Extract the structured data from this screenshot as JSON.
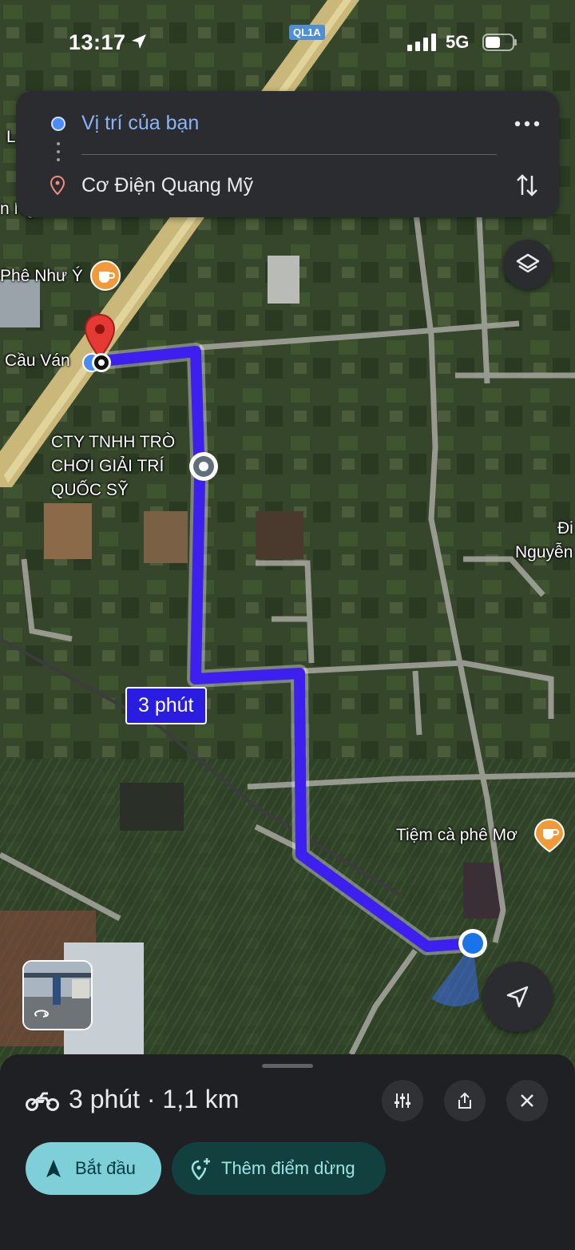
{
  "status_bar": {
    "time": "13:17",
    "network": "5G"
  },
  "route_card": {
    "origin": "Vị trí của bạn",
    "destination": "Cơ Điện Quang Mỹ"
  },
  "map": {
    "road_badge": "QL1A",
    "route_time_label": "3 phút",
    "labels": {
      "cafe_left": "Phê Như Ý",
      "dest_label": "Cầu Ván",
      "company_line1": "CTY TNHH TRÒ",
      "company_line2": "CHƠI GIẢI TRÍ",
      "company_line3": "QUỐC SỸ",
      "cafe_right": "Tiệm cà phê Mơ",
      "right_top1": "Đi",
      "right_top2": "Nguyễn",
      "left_top1": "L",
      "left_top2": "n Ng"
    }
  },
  "bottom_sheet": {
    "summary": "3 phút · 1,1 km",
    "start_label": "Bắt đầu",
    "add_stop_label": "Thêm điểm dừng"
  },
  "colors": {
    "route": "#3d1ff0",
    "accent_blue": "#8ab4f8",
    "start_button": "#7fcfd9",
    "add_stop_button": "#11403f"
  },
  "icons": [
    "location-arrow-icon",
    "signal-icon",
    "battery-icon",
    "origin-dot-icon",
    "destination-pin-icon",
    "more-icon",
    "swap-icon",
    "layers-icon",
    "coffee-icon",
    "red-pin-icon",
    "waypoint-icon",
    "my-location-dot-icon",
    "navigate-icon",
    "street-view-icon",
    "motorbike-icon",
    "tune-icon",
    "share-icon",
    "close-icon",
    "navigation-arrow-icon",
    "add-stop-icon"
  ]
}
